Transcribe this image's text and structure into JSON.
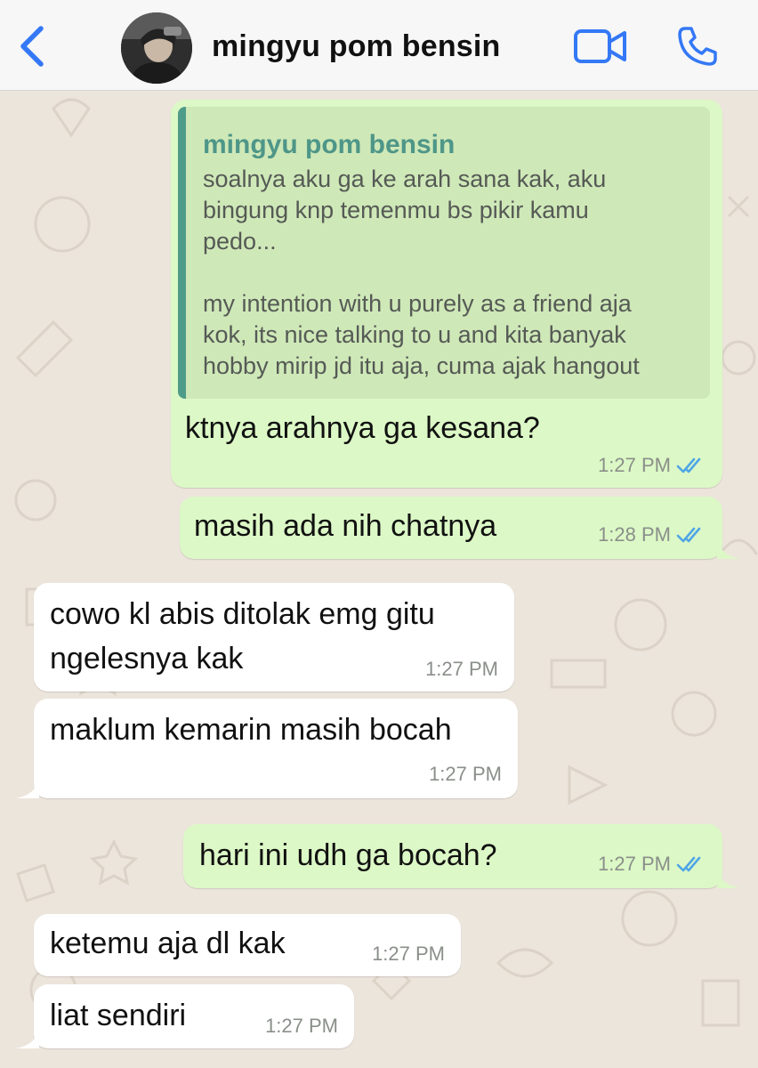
{
  "header": {
    "contact_name": "mingyu pom bensin",
    "back_icon": "chevron-left-icon",
    "video_icon": "video-camera-icon",
    "call_icon": "phone-icon",
    "accent_color": "#3478f6"
  },
  "colors": {
    "outgoing_bubble": "#dcf8c6",
    "incoming_bubble": "#ffffff",
    "quote_bar": "#4f9b8a",
    "read_ticks": "#4fa6e6"
  },
  "messages": [
    {
      "direction": "outgoing",
      "reply_to": {
        "author": "mingyu pom bensin",
        "text": "soalnya aku ga ke arah sana kak, aku\nbingung knp temenmu bs pikir kamu\npedo...\n\nmy intention with u purely as a friend aja\nkok, its nice talking to u and kita banyak\nhobby mirip jd itu aja, cuma ajak hangout"
      },
      "text": "ktnya arahnya ga kesana?",
      "time": "1:27 PM",
      "status": "read"
    },
    {
      "direction": "outgoing",
      "text": "masih ada nih chatnya",
      "time": "1:28 PM",
      "status": "read"
    },
    {
      "direction": "incoming",
      "text": "cowo kl abis ditolak emg gitu\nngelesnya kak",
      "time": "1:27 PM"
    },
    {
      "direction": "incoming",
      "text": "maklum kemarin masih bocah",
      "time": "1:27 PM"
    },
    {
      "direction": "outgoing",
      "text": "hari ini udh ga bocah?",
      "time": "1:27 PM",
      "status": "read"
    },
    {
      "direction": "incoming",
      "text": "ketemu aja dl kak",
      "time": "1:27 PM"
    },
    {
      "direction": "incoming",
      "text": "liat sendiri",
      "time": "1:27 PM"
    }
  ]
}
